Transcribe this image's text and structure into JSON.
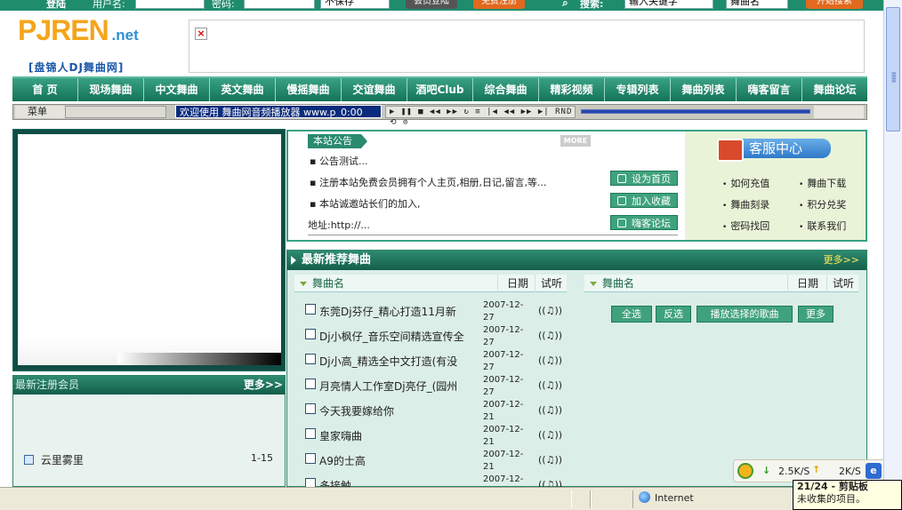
{
  "topbar": {
    "login_label": "登陆",
    "username_label": "用户名:",
    "password_label": "密码:",
    "remember_value": "不保存",
    "member_login_btn": "会员登陆",
    "register_btn": "免费注册",
    "search_label": "搜索:",
    "search_placeholder": "输入关键字",
    "search_type": "舞曲名",
    "search_btn": "开始搜索"
  },
  "header": {
    "logo_main": "PJREN",
    "logo_net": ".net",
    "logo_sub": "[盘锦人DJ舞曲网]",
    "ad_close": "×"
  },
  "nav": {
    "items": [
      "首 页",
      "现场舞曲",
      "中文舞曲",
      "英文舞曲",
      "慢摇舞曲",
      "交谊舞曲",
      "酒吧Club",
      "综合舞曲",
      "精彩视频",
      "专辑列表",
      "舞曲列表",
      "嗨客留言",
      "舞曲论坛"
    ]
  },
  "player": {
    "menu_label": "菜单",
    "scroll_text": "欢迎使用 舞曲网音频播放器 www.p_0:00",
    "controls": "▶ ❚❚ ■ ◀◀ ▶▶ ↻ ≡ |◀ ◀◀ ▶▶ ▶| RND ⟲ ⊙"
  },
  "members": {
    "title": "最新注册会员",
    "more": "更多>>",
    "name": "云里雾里",
    "range": "1-15"
  },
  "notice": {
    "tab": "本站公告",
    "more": "MORE",
    "lines": [
      "▪ 公告测试...",
      "▪ 注册本站免费会员拥有个人主页,相册,日记,留言,等...",
      "▪ 本站诚邀站长们的加入,"
    ],
    "address": "地址:http://...",
    "buttons": [
      "设为首页",
      "加入收藏",
      "嗨客论坛"
    ]
  },
  "service": {
    "title": "客服中心",
    "links": [
      "如何充值",
      "舞曲下载",
      "舞曲刻录",
      "积分兑奖",
      "密码找回",
      "联系我们"
    ]
  },
  "recommend": {
    "title": "最新推荐舞曲",
    "more": "更多>>",
    "col_name": "舞曲名",
    "col_date": "日期",
    "col_try": "试听",
    "songs": [
      {
        "name": "东莞Dj芬仔_精心打造11月新",
        "date": "2007-12-27",
        "try": "((♫))"
      },
      {
        "name": "Dj小枫仔_音乐空间精选宣传全",
        "date": "2007-12-27",
        "try": "((♫))"
      },
      {
        "name": "Dj小高_精选全中文打造(有没",
        "date": "2007-12-27",
        "try": "((♫))"
      },
      {
        "name": "月亮情人工作室Dj亮仔_(园州",
        "date": "2007-12-27",
        "try": "((♫))"
      },
      {
        "name": "今天我要嫁给你",
        "date": "2007-12-21",
        "try": "((♫))"
      },
      {
        "name": "皇家嗨曲",
        "date": "2007-12-21",
        "try": "((♫))"
      },
      {
        "name": "A9的士高",
        "date": "2007-12-21",
        "try": "((♫))"
      },
      {
        "name": "多接触",
        "date": "2007-12-",
        "try": "((♫))"
      }
    ],
    "actions": [
      "全选",
      "反选",
      "播放选择的歌曲",
      "更多"
    ]
  },
  "status": {
    "zone": "Internet"
  },
  "speed": {
    "down": "2.5K/S",
    "up": "2K/S"
  },
  "clipboard": {
    "line1": "21/24 - 剪贴板",
    "line2": "未收集的项目。"
  },
  "colors": {
    "brand_green": "#1f8c6c",
    "nav_green": "#137357",
    "player_blue": "#0b2c7c",
    "panel_bg": "#dbeee8"
  }
}
